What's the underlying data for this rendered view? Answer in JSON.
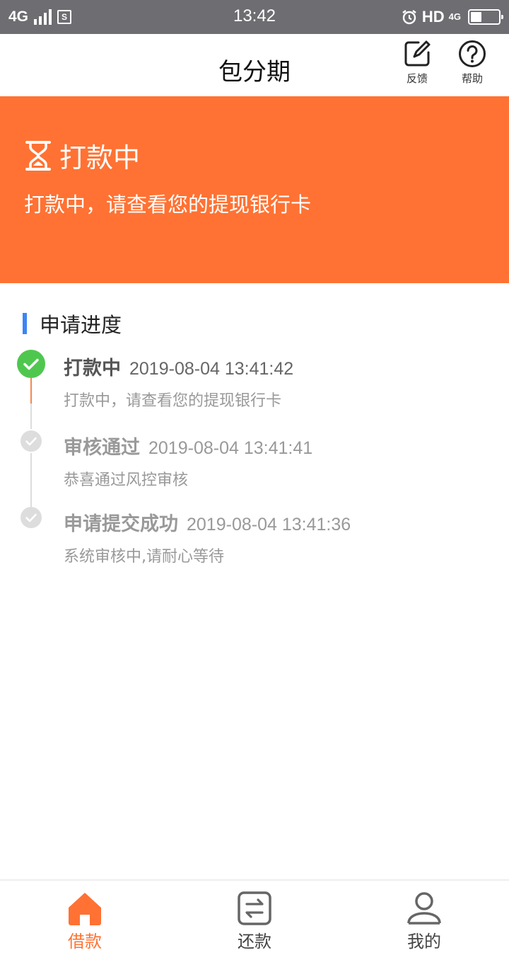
{
  "status_bar": {
    "network": "4G",
    "time": "13:42",
    "hd": "HD",
    "net_small": "4G",
    "sim": "S",
    "battery_level": 0.4
  },
  "header": {
    "title": "包分期",
    "feedback_label": "反馈",
    "help_label": "帮助"
  },
  "banner": {
    "status_title": "打款中",
    "status_desc": "打款中，请查看您的提现银行卡",
    "color": "#ff7233",
    "icon": "hourglass-icon"
  },
  "progress": {
    "title": "申请进度",
    "accent": "#3d84f6",
    "items": [
      {
        "name": "打款中",
        "time": "2019-08-04 13:41:42",
        "desc": "打款中，请查看您的提现银行卡",
        "active": true
      },
      {
        "name": "审核通过",
        "time": "2019-08-04 13:41:41",
        "desc": "恭喜通过风控审核",
        "active": false
      },
      {
        "name": "申请提交成功",
        "time": "2019-08-04 13:41:36",
        "desc": "系统审核中,请耐心等待",
        "active": false
      }
    ]
  },
  "tabbar": {
    "active_color": "#ff7233",
    "inactive_color": "#666666",
    "tabs": [
      {
        "label": "借款",
        "icon": "home-icon",
        "active": true
      },
      {
        "label": "还款",
        "icon": "exchange-icon",
        "active": false
      },
      {
        "label": "我的",
        "icon": "user-icon",
        "active": false
      }
    ]
  }
}
